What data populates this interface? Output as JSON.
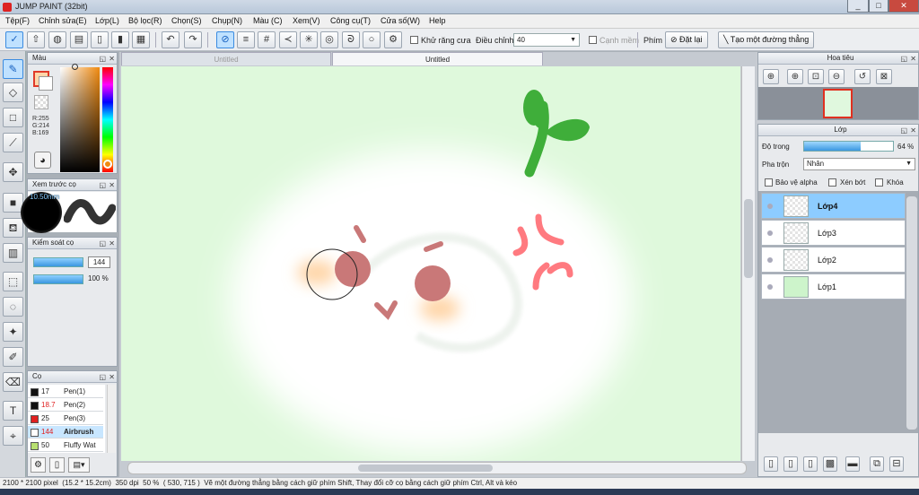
{
  "window": {
    "title": "JUMP PAINT (32bit)",
    "controls": [
      "_",
      "□",
      "✕"
    ]
  },
  "menu": [
    "Tệp(F)",
    "Chỉnh sửa(E)",
    "Lớp(L)",
    "Bộ lọc(R)",
    "Chọn(S)",
    "Chụp(N)",
    "Màu (C)",
    "Xem(V)",
    "Công cụ(T)",
    "Cửa số(W)",
    "Help"
  ],
  "toolbar": {
    "antialias_label": "Khử răng cưa",
    "adjust_label": "Điều chỉnh",
    "adjust_value": "40",
    "edge_label": "Cạnh mềm",
    "key_label": "Phím",
    "reset_label": "Đặt lại",
    "line_label": "Tạo một đường thẳng"
  },
  "color_panel": {
    "title": "Màu",
    "r": "R:255",
    "g": "G:214",
    "b": "B:169",
    "fg": "#ffd6a9"
  },
  "preview_panel": {
    "title": "Xem trước cọ",
    "size": "10.50mm"
  },
  "control_panel": {
    "title": "Kiểm soát cọ",
    "size_value": "144",
    "opacity_value": "100 %"
  },
  "brush_panel": {
    "title": "Cọ",
    "brushes": [
      {
        "size": "17",
        "name": "Pen(1)",
        "color": "#111111"
      },
      {
        "size": "18.7",
        "name": "Pen(2)",
        "color": "#111111"
      },
      {
        "size": "25",
        "name": "Pen(3)",
        "color": "#e02020"
      },
      {
        "size": "144",
        "name": "Airbrush",
        "color": "#ffffff"
      },
      {
        "size": "50",
        "name": "Fluffy Wat",
        "color": "#b8e070"
      }
    ]
  },
  "tabs": [
    "Untitled",
    "Untitled"
  ],
  "navigator": {
    "title": "Hoa tiêu"
  },
  "layers_panel": {
    "title": "Lớp",
    "opacity_label": "Độ trong",
    "opacity_value": "64 %",
    "opacity_fraction": 0.64,
    "blend_label": "Pha trộn",
    "blend_value": "Nhân",
    "protect_alpha": "Bảo vệ alpha",
    "clip_label": "Xén bớt",
    "lock_label": "Khóa",
    "layers": [
      {
        "name": "Lớp4",
        "selected": true
      },
      {
        "name": "Lớp3",
        "selected": false
      },
      {
        "name": "Lớp2",
        "selected": false
      },
      {
        "name": "Lớp1",
        "selected": false
      }
    ]
  },
  "status": {
    "size": "2100 * 2100 pixel",
    "cm": "(15.2 * 15.2cm)",
    "dpi": "350 dpi",
    "zoom": "50 %",
    "coords": "( 530, 715 )",
    "hint": "Vẽ một đường thẳng bằng cách giữ phím Shift, Thay đổi cỡ cọ bằng cách giữ phím Ctrl, Alt và kéo"
  },
  "colors": {
    "accent": "#3b8be0",
    "canvas_bg": "#dff9dc",
    "sprout": "#3fae3a",
    "cheek": "#c97878",
    "anger": "#ff7a80"
  }
}
